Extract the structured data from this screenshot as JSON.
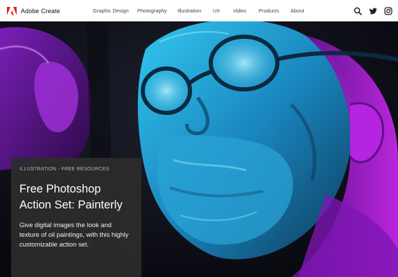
{
  "header": {
    "brand": "Adobe Create",
    "nav": [
      {
        "label": "Graphic Design"
      },
      {
        "label": "Photography"
      },
      {
        "label": "Illustration"
      },
      {
        "label": "UX"
      },
      {
        "label": "Video"
      },
      {
        "label": "Products"
      },
      {
        "label": "About"
      }
    ],
    "icons": [
      "search-icon",
      "twitter-icon",
      "instagram-icon"
    ]
  },
  "hero": {
    "image": "stylized oil-painting portrait of a bearded man wearing round glasses in cyan and purple light",
    "category": "ILLUSTRATION - FREE RESOURCES",
    "title": "Free Photoshop Action Set: Painterly",
    "description": "Give digital images the look and texture of oil paintings, with this highly customizable action set."
  },
  "colors": {
    "header_bg": "#ffffff",
    "brand_red": "#e1251b",
    "card_bg": "#2d2d2d",
    "hero_cyan": "#1fb6e6",
    "hero_purple": "#b01ed8"
  }
}
